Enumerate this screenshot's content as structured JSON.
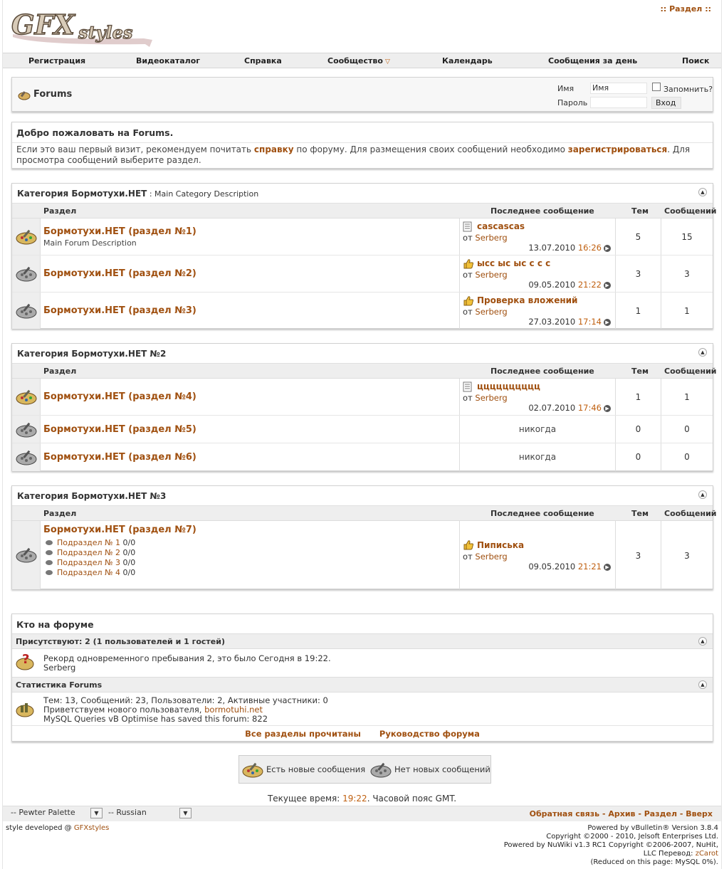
{
  "header": {
    "logo_text": "GFXstyles",
    "top_link": ":: Раздел ::"
  },
  "nav": [
    "Регистрация",
    "Видеокаталог",
    "Справка",
    "Сообщество",
    "Календарь",
    "Сообщения за день",
    "Поиск"
  ],
  "login": {
    "title": "Forums",
    "name_label": "Имя",
    "name_value": "Имя",
    "remember": "Запомнить?",
    "password_label": "Пароль",
    "login_button": "Вход"
  },
  "welcome": {
    "title": "Добро пожаловать на Forums.",
    "text_1": "Если это ваш первый визит, рекомендуем почитать ",
    "link_1": "справку",
    "text_2": " по форуму. Для размещения своих сообщений необходимо ",
    "link_2": "зарегистрироваться",
    "text_3": ". Для просмотра сообщений выберите раздел."
  },
  "columns": {
    "forum": "Раздел",
    "last_post": "Последнее сообщение",
    "threads": "Тем",
    "posts": "Сообщений"
  },
  "by": "от",
  "never": "никогда",
  "categories": [
    {
      "title": "Категория Бормотухи.НЕТ",
      "desc": " : Main Category Description",
      "forums": [
        {
          "name": "Бормотухи.НЕТ (раздел №1)",
          "desc": "Main Forum Description",
          "last_title": "cascascas",
          "last_user": "Serberg",
          "last_date": "13.07.2010",
          "last_time": "16:26",
          "threads": "5",
          "posts": "15"
        },
        {
          "name": "Бормотухи.НЕТ (раздел №2)",
          "desc": "",
          "last_title": "ысс ыс ыс с с с",
          "last_user": "Serberg",
          "last_date": "09.05.2010",
          "last_time": "21:22",
          "threads": "3",
          "posts": "3"
        },
        {
          "name": "Бормотухи.НЕТ (раздел №3)",
          "desc": "",
          "last_title": "Проверка вложений",
          "last_user": "Serberg",
          "last_date": "27.03.2010",
          "last_time": "17:14",
          "threads": "1",
          "posts": "1"
        }
      ]
    },
    {
      "title": "Категория Бормотухи.НЕТ №2",
      "desc": "",
      "forums": [
        {
          "name": "Бормотухи.НЕТ (раздел №4)",
          "last_title": "цццццццццц",
          "last_user": "Serberg",
          "last_date": "02.07.2010",
          "last_time": "17:46",
          "threads": "1",
          "posts": "1"
        },
        {
          "name": "Бормотухи.НЕТ (раздел №5)",
          "threads": "0",
          "posts": "0"
        },
        {
          "name": "Бормотухи.НЕТ (раздел №6)",
          "threads": "0",
          "posts": "0"
        }
      ]
    },
    {
      "title": "Категория Бормотухи.НЕТ №3",
      "desc": "",
      "forums": [
        {
          "name": "Бормотухи.НЕТ (раздел №7)",
          "last_title": "Пиписька",
          "last_user": "Serberg",
          "last_date": "09.05.2010",
          "last_time": "21:21",
          "threads": "3",
          "posts": "3",
          "subforums": [
            {
              "name": "Подраздел № 1",
              "counts": " 0/0"
            },
            {
              "name": "Подраздел № 2",
              "counts": " 0/0"
            },
            {
              "name": "Подраздел № 3",
              "counts": " 0/0"
            },
            {
              "name": "Подраздел № 4",
              "counts": " 0/0"
            }
          ]
        }
      ]
    }
  ],
  "online": {
    "title": "Кто на форуме",
    "present": "Присутствуют: 2 (1 пользователей и 1 гостей)",
    "record": "Рекорд одновременного пребывания 2, это было Сегодня в 19:22.",
    "user": "Serberg",
    "stats_title": "Статистика Forums",
    "stats": "Тем: 13, Сообщений: 23, Пользователи: 2, Активные участники: 0",
    "welcome_new": "Приветствуем нового пользователя, ",
    "new_user": "bormotuhi.net",
    "mysql": "MySQL Queries vB Optimise has saved this forum: 822",
    "mark_read": "Все разделы прочитаны",
    "guide": "Руководство форума"
  },
  "legend": {
    "new": "Есть новые сообщения",
    "nonew": "Нет новых сообщений"
  },
  "time": {
    "label": "Текущее время: ",
    "value": "19:22",
    "tz": ". Часовой пояс GMT."
  },
  "footer": {
    "style_select": "-- Pewter Palette",
    "lang_select": "-- Russian",
    "links": "Обратная связь - Архив - Раздел - Вверх",
    "dev": "style developed @ ",
    "dev_link": "GFXstyles",
    "copy_1": "Powered by vBulletin® Version 3.8.4",
    "copy_2": "Copyright ©2000 - 2010, Jelsoft Enterprises Ltd.",
    "copy_3": "Powered by NuWiki v1.3 RC1 Copyright ©2006-2007, NuHit,",
    "copy_4": "LLC Перевод: ",
    "copy_4_link": "zCarot",
    "copy_5": "(Reduced on this page: MySQL 0%)."
  },
  "colors": {
    "accent": "#a05010",
    "time": "#c06010",
    "header_bg": "#eeeeee"
  }
}
